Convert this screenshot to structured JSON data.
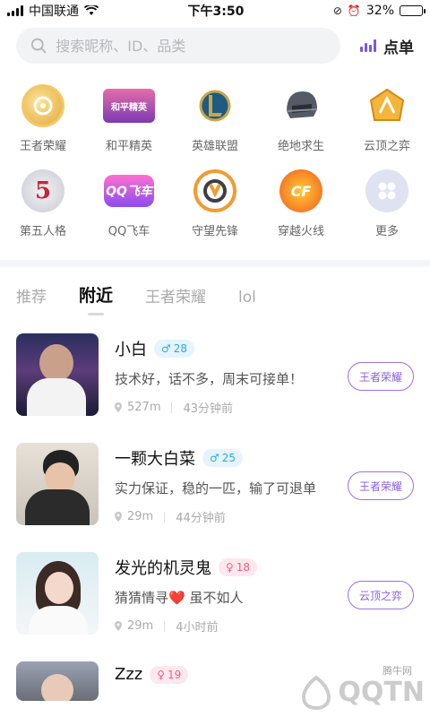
{
  "status_bar": {
    "carrier": "中国联通",
    "time": "下午3:50",
    "battery": "32%",
    "battery_level": 0.32
  },
  "header": {
    "search_placeholder": "搜索昵称、ID、品类",
    "order_label": "点单"
  },
  "categories": [
    {
      "label": "王者荣耀",
      "icon": "honor-of-kings-icon"
    },
    {
      "label": "和平精英",
      "icon": "peace-elite-icon"
    },
    {
      "label": "英雄联盟",
      "icon": "league-of-legends-icon"
    },
    {
      "label": "绝地求生",
      "icon": "pubg-helmet-icon"
    },
    {
      "label": "云顶之弈",
      "icon": "tft-icon"
    },
    {
      "label": "第五人格",
      "icon": "identity-v-icon"
    },
    {
      "label": "QQ飞车",
      "icon": "qq-speed-icon"
    },
    {
      "label": "守望先锋",
      "icon": "overwatch-icon"
    },
    {
      "label": "穿越火线",
      "icon": "crossfire-icon"
    },
    {
      "label": "更多",
      "icon": "more-grid-icon"
    }
  ],
  "tabs": [
    {
      "label": "推荐",
      "active": false
    },
    {
      "label": "附近",
      "active": true
    },
    {
      "label": "王者荣耀",
      "active": false
    },
    {
      "label": "lol",
      "active": false
    }
  ],
  "users": [
    {
      "name": "小白",
      "gender": "♂",
      "age": "28",
      "desc": "技术好，话不多，周末可接单！",
      "distance": "527m",
      "time": "43分钟前",
      "tag": "王者荣耀"
    },
    {
      "name": "一颗大白菜",
      "gender": "♂",
      "age": "25",
      "desc": "实力保证，稳的一匹，输了可退单",
      "distance": "29m",
      "time": "44分钟前",
      "tag": "王者荣耀"
    },
    {
      "name": "发光的机灵鬼",
      "gender": "♀",
      "age": "18",
      "desc": "猜猜情寻❤️ 虽不如人",
      "distance": "29m",
      "time": "4小时前",
      "tag": "云顶之弈"
    },
    {
      "name": "Zzz",
      "gender": "♀",
      "age": "19"
    }
  ],
  "watermark": {
    "text": "QQTN",
    "sub": "腾牛网"
  },
  "colors": {
    "accent": "#8a5de8",
    "male": "#2da9e3",
    "female": "#ef5e86"
  }
}
